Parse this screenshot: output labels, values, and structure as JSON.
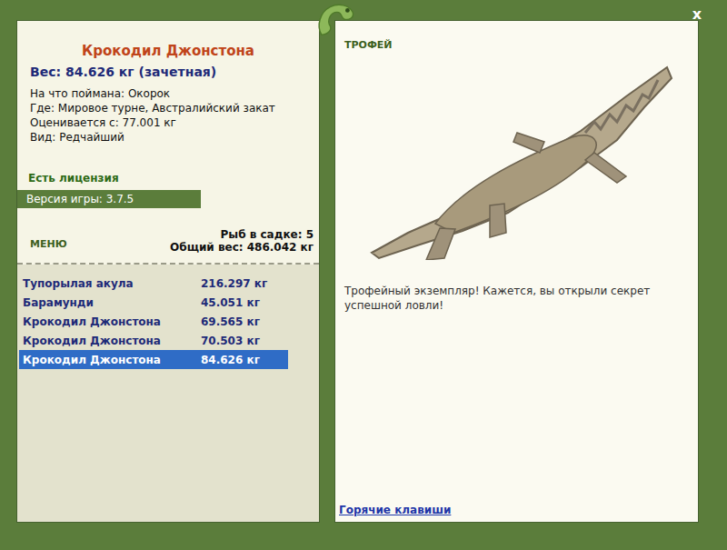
{
  "window": {
    "close": "x"
  },
  "fish": {
    "title": "Крокодил Джонстона",
    "weight": "Вес: 84.626 кг (зачетная)",
    "details": [
      "На что поймана: Окорок",
      "Где: Мировое турне, Австралийский закат",
      "Оценивается с: 77.001 кг",
      "Вид: Редчайший"
    ]
  },
  "license": "Есть лицензия",
  "version": "Версия игры: 3.7.5",
  "menu": "МЕНЮ",
  "summary": [
    "Рыб в садке: 5",
    "Общий вес: 486.042 кг"
  ],
  "catch": [
    {
      "name": "Тупорылая акула",
      "weight": "216.297 кг",
      "selected": false
    },
    {
      "name": "Барамунди",
      "weight": "45.051 кг",
      "selected": false
    },
    {
      "name": "Крокодил Джонстона",
      "weight": "69.565 кг",
      "selected": false
    },
    {
      "name": "Крокодил Джонстона",
      "weight": "70.503 кг",
      "selected": false
    },
    {
      "name": "Крокодил Джонстона",
      "weight": "84.626 кг",
      "selected": true
    }
  ],
  "trophy": {
    "label": "ТРОФЕЙ",
    "message": "Трофейный экземпляр! Кажется, вы открыли секрет успешной ловли!"
  },
  "hotkeys": "Горячие клавиши"
}
